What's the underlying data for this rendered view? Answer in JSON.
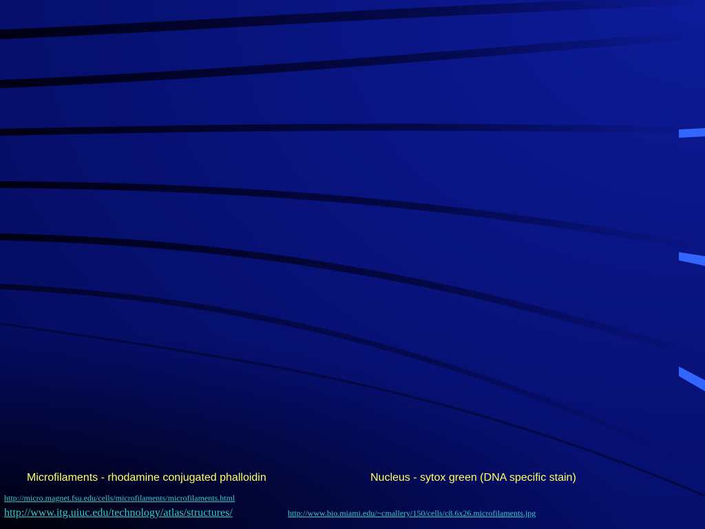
{
  "captions": {
    "left": "Microfilaments - rhodamine conjugated phalloidin",
    "right": "Nucleus - sytox green (DNA specific stain)"
  },
  "links": {
    "magnet": "http://micro.magnet.fsu.edu/cells/microfilaments/microfilaments.html",
    "itg": "http://www.itg.uiuc.edu/technology/atlas/structures/",
    "miami": "http://www.bio.miami.edu/~cmallery/150/cells/c8.6x26.microfilaments.jpg"
  },
  "colors": {
    "background": "#08137d",
    "caption_text": "#ffff66",
    "link_text": "#33cccc",
    "accent_stripe": "#3366ff"
  }
}
